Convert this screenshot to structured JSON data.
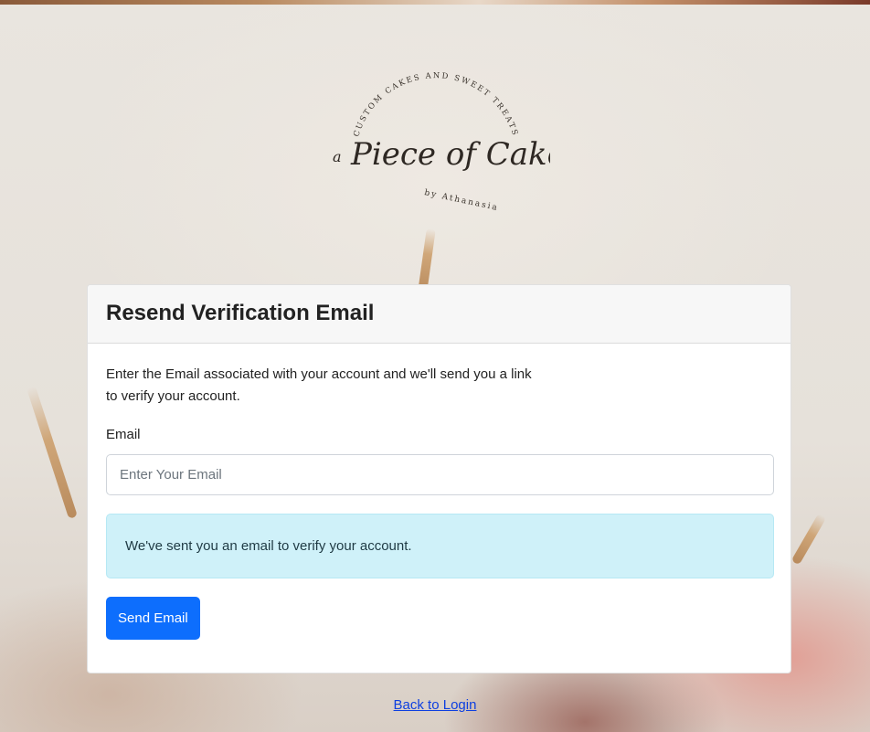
{
  "logo": {
    "arc_text": "CUSTOM CAKES AND SWEET TREATS",
    "prefix": "a",
    "brand": "Piece of Cake",
    "byline": "by Athanasia"
  },
  "card": {
    "title": "Resend Verification Email",
    "description": "Enter the Email associated with your account and we'll send you a link to verify your account.",
    "email_label": "Email",
    "email_placeholder": "Enter Your Email",
    "email_value": "",
    "alert_message": "We've sent you an email to verify your account.",
    "submit_label": "Send Email"
  },
  "footer": {
    "back_link_label": "Back to Login"
  },
  "colors": {
    "primary": "#0d6efd",
    "alert_bg": "#cff1f9",
    "link": "#0d3fe0"
  }
}
